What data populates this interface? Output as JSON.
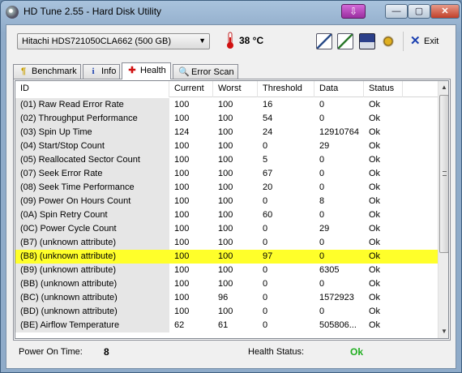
{
  "window": {
    "title": "HD Tune 2.55 - Hard Disk Utility",
    "download_glyph": "⇩",
    "minimize_glyph": "—",
    "maximize_glyph": "▢",
    "close_glyph": "✕"
  },
  "toolbar": {
    "drive": "Hitachi HDS721050CLA662 (500 GB)",
    "dropdown_glyph": "▼",
    "temperature": "38 °C",
    "exit_glyph": "✕",
    "exit_label": "Exit",
    "icons": [
      "copy-text-icon",
      "copy-screenshot-icon",
      "save-icon",
      "options-icon",
      "exit-icon",
      "thermometer-icon"
    ]
  },
  "tabs": [
    {
      "label": "Benchmark",
      "glyph": "¶",
      "icon": "benchmark-icon",
      "active": false
    },
    {
      "label": "Info",
      "glyph": "i",
      "icon": "info-icon",
      "active": false
    },
    {
      "label": "Health",
      "glyph": "✚",
      "icon": "health-cross-icon",
      "active": true
    },
    {
      "label": "Error Scan",
      "glyph": "🔍",
      "icon": "error-scan-icon",
      "active": false
    }
  ],
  "table": {
    "columns": [
      "ID",
      "Current",
      "Worst",
      "Threshold",
      "Data",
      "Status"
    ],
    "rows": [
      [
        "(01) Raw Read Error Rate",
        "100",
        "100",
        "16",
        "0",
        "Ok"
      ],
      [
        "(02) Throughput Performance",
        "100",
        "100",
        "54",
        "0",
        "Ok"
      ],
      [
        "(03) Spin Up Time",
        "124",
        "100",
        "24",
        "12910764",
        "Ok"
      ],
      [
        "(04) Start/Stop Count",
        "100",
        "100",
        "0",
        "29",
        "Ok"
      ],
      [
        "(05) Reallocated Sector Count",
        "100",
        "100",
        "5",
        "0",
        "Ok"
      ],
      [
        "(07) Seek Error Rate",
        "100",
        "100",
        "67",
        "0",
        "Ok"
      ],
      [
        "(08) Seek Time Performance",
        "100",
        "100",
        "20",
        "0",
        "Ok"
      ],
      [
        "(09) Power On Hours Count",
        "100",
        "100",
        "0",
        "8",
        "Ok"
      ],
      [
        "(0A) Spin Retry Count",
        "100",
        "100",
        "60",
        "0",
        "Ok"
      ],
      [
        "(0C) Power Cycle Count",
        "100",
        "100",
        "0",
        "29",
        "Ok"
      ],
      [
        "(B7) (unknown attribute)",
        "100",
        "100",
        "0",
        "0",
        "Ok"
      ],
      [
        "(B8) (unknown attribute)",
        "100",
        "100",
        "97",
        "0",
        "Ok"
      ],
      [
        "(B9) (unknown attribute)",
        "100",
        "100",
        "0",
        "6305",
        "Ok"
      ],
      [
        "(BB) (unknown attribute)",
        "100",
        "100",
        "0",
        "0",
        "Ok"
      ],
      [
        "(BC) (unknown attribute)",
        "100",
        "96",
        "0",
        "1572923",
        "Ok"
      ],
      [
        "(BD) (unknown attribute)",
        "100",
        "100",
        "0",
        "0",
        "Ok"
      ],
      [
        "(BE) Airflow Temperature",
        "62",
        "61",
        "0",
        "505806...",
        "Ok"
      ]
    ],
    "highlighted_row": 11,
    "highlight_color": "#ffff2a"
  },
  "scrollbar": {
    "up_glyph": "▲",
    "down_glyph": "▼"
  },
  "footer": {
    "power_on_time_label": "Power On Time:",
    "power_on_time_value": "8",
    "health_status_label": "Health Status:",
    "health_status_value": "Ok",
    "health_status_color": "#1fae1f"
  }
}
